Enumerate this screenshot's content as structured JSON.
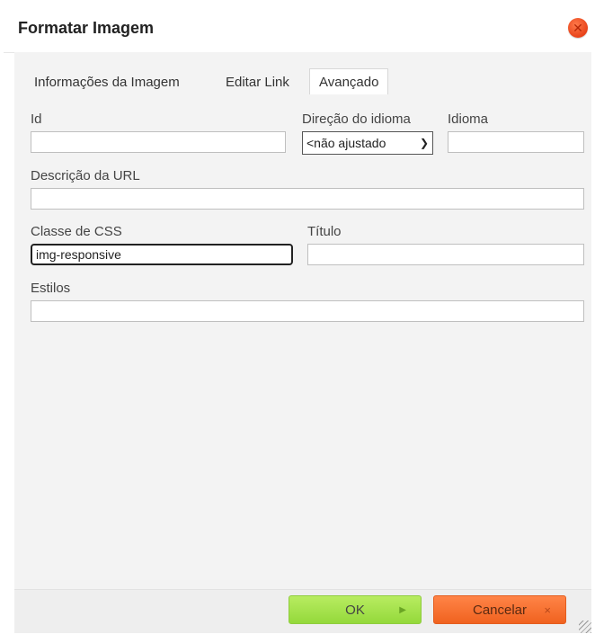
{
  "dialog": {
    "title": "Formatar Imagem"
  },
  "tabs": [
    {
      "label": "Informações da Imagem",
      "active": false
    },
    {
      "label": "Editar Link",
      "active": false
    },
    {
      "label": "Avançado",
      "active": true
    }
  ],
  "fields": {
    "id": {
      "label": "Id",
      "value": ""
    },
    "direction": {
      "label": "Direção do idioma",
      "selected": "<não ajustado"
    },
    "language": {
      "label": "Idioma",
      "value": ""
    },
    "long_desc": {
      "label": "Descrição da URL",
      "value": ""
    },
    "css_class": {
      "label": "Classe de CSS",
      "value": "img-responsive"
    },
    "title": {
      "label": "Título",
      "value": ""
    },
    "styles": {
      "label": "Estilos",
      "value": ""
    }
  },
  "buttons": {
    "ok": "OK",
    "cancel": "Cancelar"
  },
  "colors": {
    "ok": "#a6e44d",
    "cancel": "#f66d2b",
    "close": "#e8431a"
  }
}
